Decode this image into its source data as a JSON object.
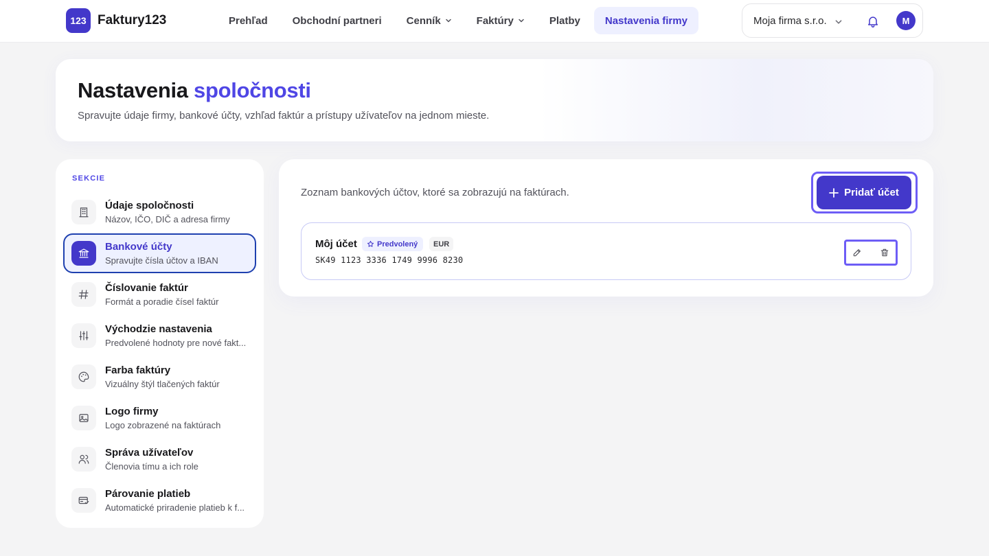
{
  "app": {
    "logo_badge": "123",
    "name": "Faktury123"
  },
  "nav": {
    "items": [
      {
        "label": "Prehľad"
      },
      {
        "label": "Obchodní partneri"
      },
      {
        "label": "Cenník",
        "dropdown": true
      },
      {
        "label": "Faktúry",
        "dropdown": true
      },
      {
        "label": "Platby"
      },
      {
        "label": "Nastavenia firmy",
        "active": true
      }
    ]
  },
  "account": {
    "firm_name": "Moja firma s.r.o.",
    "avatar_initial": "M"
  },
  "hero": {
    "title_plain": "Nastavenia",
    "title_accent": "spoločnosti",
    "subtitle": "Spravujte údaje firmy, bankové účty, vzhľad faktúr a prístupy užívateľov na jednom mieste."
  },
  "sidebar": {
    "heading": "SEKCIE",
    "items": [
      {
        "title": "Údaje spoločnosti",
        "desc": "Názov, IČO, DIČ a adresa firmy",
        "icon": "building-icon"
      },
      {
        "title": "Bankové účty",
        "desc": "Spravujte čísla účtov a IBAN",
        "icon": "bank-icon",
        "active": true
      },
      {
        "title": "Číslovanie faktúr",
        "desc": "Formát a poradie čísel faktúr",
        "icon": "hash-icon"
      },
      {
        "title": "Východzie nastavenia",
        "desc": "Predvolené hodnoty pre nové fakt...",
        "icon": "sliders-icon"
      },
      {
        "title": "Farba faktúry",
        "desc": "Vizuálny štýl tlačených faktúr",
        "icon": "palette-icon"
      },
      {
        "title": "Logo firmy",
        "desc": "Logo zobrazené na faktúrach",
        "icon": "image-icon"
      },
      {
        "title": "Správa užívateľov",
        "desc": "Členovia tímu a ich role",
        "icon": "users-icon"
      },
      {
        "title": "Párovanie platieb",
        "desc": "Automatické priradenie platieb k f...",
        "icon": "card-match-icon"
      }
    ]
  },
  "main": {
    "description": "Zoznam bankových účtov, ktoré sa zobrazujú na faktúrach.",
    "add_button": "Pridať účet",
    "accounts": [
      {
        "name": "Môj účet",
        "default_badge": "Predvolený",
        "currency": "EUR",
        "iban": "SK49 1123 3336 1749 9996 8230"
      }
    ]
  },
  "colors": {
    "accent": "#4338ca",
    "accent_light": "#eef0ff",
    "focus_ring": "#6d5df6",
    "active_border": "#1e40af"
  }
}
